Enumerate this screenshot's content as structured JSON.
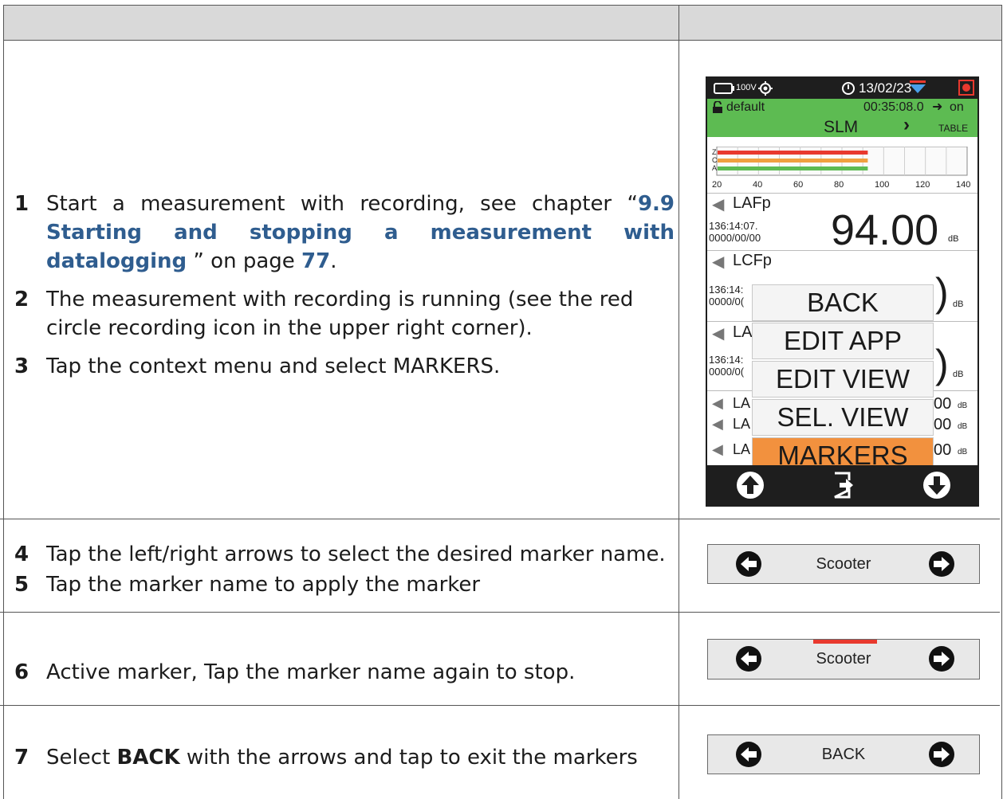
{
  "steps": [
    {
      "num": "1",
      "pre": "Start a measurement with recording, see chapter “",
      "link": "9.9 Starting and stopping a measurement with datalogging",
      "post": " ” on page ",
      "page": "77",
      "end": "."
    },
    {
      "num": "2",
      "text": "The measurement with recording is running (see the red circle recording icon in the upper right corner)."
    },
    {
      "num": "3",
      "text": "Tap the context menu and select MARKERS."
    },
    {
      "num": "4",
      "text": "Tap the left/right arrows to select the desired marker name."
    },
    {
      "num": "5",
      "text": "Tap the marker name to apply the marker"
    },
    {
      "num": "6",
      "text": "Active marker, Tap the marker name again to stop."
    },
    {
      "num": "7",
      "pre": "Select ",
      "bold": "BACK",
      "post": " with the arrows and tap to exit the markers"
    }
  ],
  "device": {
    "battery": "100V",
    "date": "13/02/23",
    "profile": "default",
    "timer": "00:35:08.0",
    "on_label": "on",
    "mode": "SLM",
    "next_label": "TABLE",
    "meter_letters": [
      "Z",
      "C",
      "A"
    ],
    "scale_ticks": [
      "20",
      "40",
      "60",
      "80",
      "100",
      "120",
      "140"
    ],
    "meter_levels": [
      0.6,
      0.6,
      0.6
    ],
    "meter_colors": [
      "#e8392e",
      "#f0a040",
      "#5dbb52"
    ],
    "readings": [
      {
        "label": "LAFp",
        "time": "136:14:07.",
        "date": "0000/00/00",
        "value": "94.00",
        "unit": "dB"
      },
      {
        "label": "LCFp",
        "time": "136:14:",
        "date": "0000/0(",
        "unit": "dB"
      },
      {
        "label": "LA",
        "time": "136:14:",
        "date": "0000/0(",
        "unit": "dB"
      }
    ],
    "small_readings": [
      {
        "label": "LA",
        "value": "00",
        "unit": "dB"
      },
      {
        "label": "LA",
        "value": "00",
        "unit": "dB"
      },
      {
        "label": "LA",
        "value": "00",
        "unit": "dB"
      }
    ],
    "menu": [
      "BACK",
      "EDIT APP",
      "EDIT VIEW",
      "SEL. VIEW",
      "MARKERS"
    ],
    "menu_selected": "MARKERS"
  },
  "marker_bars": [
    {
      "name": "Scooter",
      "active": false
    },
    {
      "name": "Scooter",
      "active": true
    },
    {
      "name": "BACK",
      "active": false
    }
  ],
  "colors": {
    "header": "#d9d9d9",
    "link": "#2f5d8f",
    "green": "#5dbb52",
    "orange": "#f2913e",
    "record": "#e8392e"
  }
}
